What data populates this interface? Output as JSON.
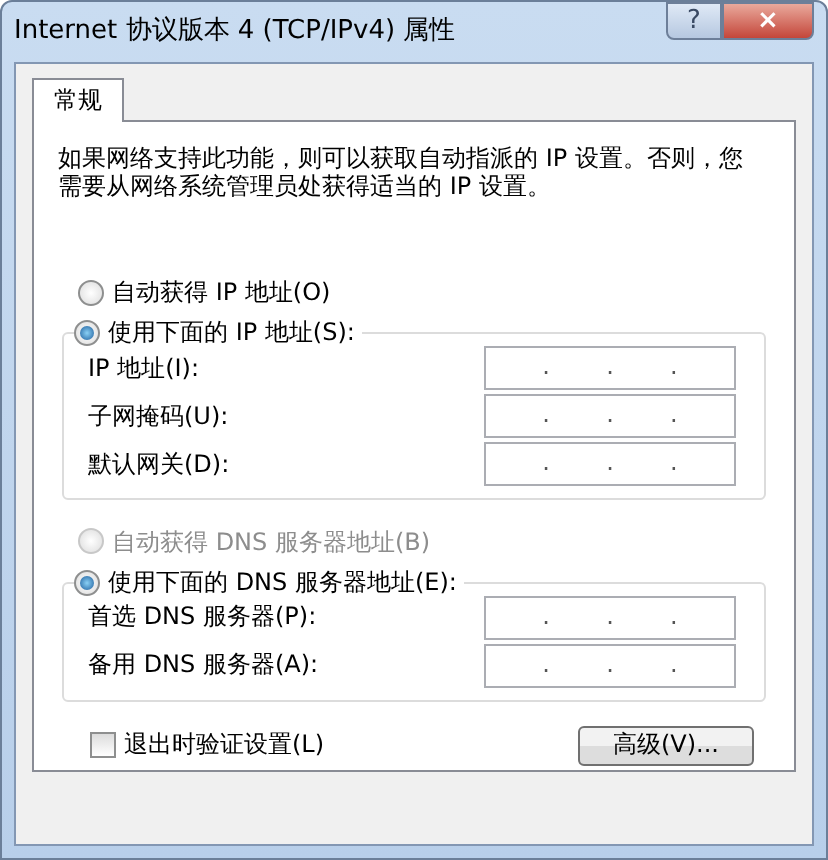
{
  "window": {
    "title": "Internet 协议版本 4 (TCP/IPv4) 属性",
    "help_button": "?",
    "close_button": "×"
  },
  "tabs": [
    {
      "label": "常规",
      "selected": true
    }
  ],
  "description": "如果网络支持此功能，则可以获取自动指派的 IP 设置。否则，您需要从网络系统管理员处获得适当的 IP 设置。",
  "ip_group": {
    "options": [
      {
        "label": "自动获得 IP 地址(O)",
        "selected": false,
        "disabled": false
      },
      {
        "label": "使用下面的 IP 地址(S):",
        "selected": true,
        "disabled": false
      }
    ],
    "fields": [
      {
        "label": "IP 地址(I):",
        "separators": [
          ".",
          ".",
          "."
        ]
      },
      {
        "label": "子网掩码(U):",
        "separators": [
          ".",
          ".",
          "."
        ]
      },
      {
        "label": "默认网关(D):",
        "separators": [
          ".",
          ".",
          "."
        ]
      }
    ]
  },
  "dns_group": {
    "options": [
      {
        "label": "自动获得 DNS 服务器地址(B)",
        "selected": false,
        "disabled": true
      },
      {
        "label": "使用下面的 DNS 服务器地址(E):",
        "selected": true,
        "disabled": false
      }
    ],
    "fields": [
      {
        "label": "首选 DNS 服务器(P):",
        "separators": [
          ".",
          ".",
          "."
        ]
      },
      {
        "label": "备用 DNS 服务器(A):",
        "separators": [
          ".",
          ".",
          "."
        ]
      }
    ]
  },
  "validate_checkbox": {
    "label": "退出时验证设置(L)",
    "checked": false
  },
  "advanced_button": "高级(V)..."
}
